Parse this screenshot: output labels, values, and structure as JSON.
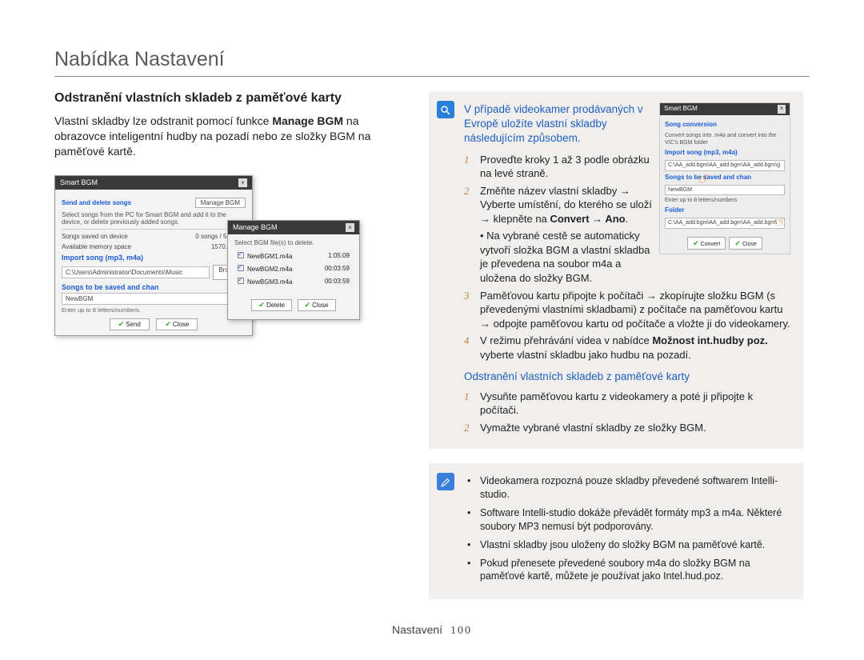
{
  "page_title": "Nabídka Nastavení",
  "left": {
    "heading": "Odstranění vlastních skladeb z paměťové karty",
    "body_prefix": "Vlastní skladby lze odstranit pomocí funkce ",
    "body_bold": "Manage BGM",
    "body_suffix": " na obrazovce inteligentní hudby na pozadí nebo ze složky BGM na paměťové kartě.",
    "dlg1": {
      "title": "Smart BGM",
      "sec1": "Send and delete songs",
      "manage_btn": "Manage BGM",
      "desc": "Select songs from the PC for Smart BGM and add it to the device, or delete previously added songs.",
      "row1_label": "Songs saved on device",
      "row1_value": "0 songs / 5 songs",
      "row2_label": "Available memory space",
      "row2_value": "1570.84 MB",
      "sec2": "Import song (mp3, m4a)",
      "path": "C:\\Users\\Administrator\\Documents\\Music",
      "browse_btn": "Browse",
      "sec3": "Songs to be saved and chan",
      "input_value": "NewBGM",
      "hint": "Enter up to 8 letters/numbers.",
      "send_btn": "Send",
      "close_btn": "Close"
    },
    "dlg2": {
      "title": "Manage BGM",
      "desc": "Select BGM file(s) to delete.",
      "items": [
        {
          "name": "NewBGM1.m4a",
          "dur": "1:05:09"
        },
        {
          "name": "NewBGM2.m4a",
          "dur": "00:03:59"
        },
        {
          "name": "NewBGM3.m4a",
          "dur": "00:03:59"
        }
      ],
      "delete_btn": "Delete",
      "close_btn": "Close"
    }
  },
  "right": {
    "info_title": "V případě videokamer prodávaných v Evropě uložíte vlastní skladby následujícím způsobem.",
    "steps": [
      "Proveďte kroky 1 až 3 podle obrázku na levé straně.",
      "Změňte název vlastní skladby → Vyberte umístění, do kterého se uloží → klepněte na ",
      "Paměťovou kartu připojte k počítači → zkopírujte složku BGM (s převedenými vlastními skladbami) z počítače na paměťovou kartu → odpojte paměťovou kartu od počítače a vložte ji do videokamery.",
      "V režimu přehrávání videa v nabídce "
    ],
    "step2_bold": "Convert → Ano",
    "step2_bullet": "Na vybrané cestě se automaticky vytvoří složka BGM a vlastní skladba je převedena na soubor m4a a uložena do složky BGM.",
    "step4_bold": "Možnost int.hudby poz.",
    "step4_suffix": " vyberte vlastní skladbu jako hudbu na pozadí.",
    "sub_title": "Odstranění vlastních skladeb z paměťové karty",
    "sub_steps": [
      "Vysuňte paměťovou kartu z videokamery a poté ji připojte k počítači.",
      "Vymažte vybrané vlastní skladby ze složky BGM."
    ],
    "inset": {
      "title": "Smart BGM",
      "sec1": "Song conversion",
      "line1": "Convert songs into .m4a and convert into the V/C's BGM folder",
      "sec2": "Import song (mp3, m4a)",
      "line2": "C:\\AA_add.bgm\\AA_add.bgm\\AA_add.bgm\\g",
      "sec3": "Songs to be saved and chan",
      "input1": "NewBGM",
      "hint": "Enter up to 8 letters/numbers",
      "sec4": "Folder",
      "input2": "C:\\AA_add.bgm\\AA_add.bgm\\AA_add.bgm\\",
      "convert_btn": "Convert",
      "close_btn": "Close"
    },
    "notes": [
      "Videokamera rozpozná pouze skladby převedené softwarem Intelli-studio.",
      "Software Intelli-studio dokáže převádět formáty mp3 a m4a. Některé soubory MP3 nemusí být podporovány.",
      "Vlastní skladby jsou uloženy do složky BGM na paměťové kartě.",
      "Pokud přenesete převedené soubory m4a do složky BGM na paměťové kartě, můžete je používat jako Intel.hud.poz."
    ]
  },
  "footer": {
    "label": "Nastavení",
    "page": "100"
  }
}
